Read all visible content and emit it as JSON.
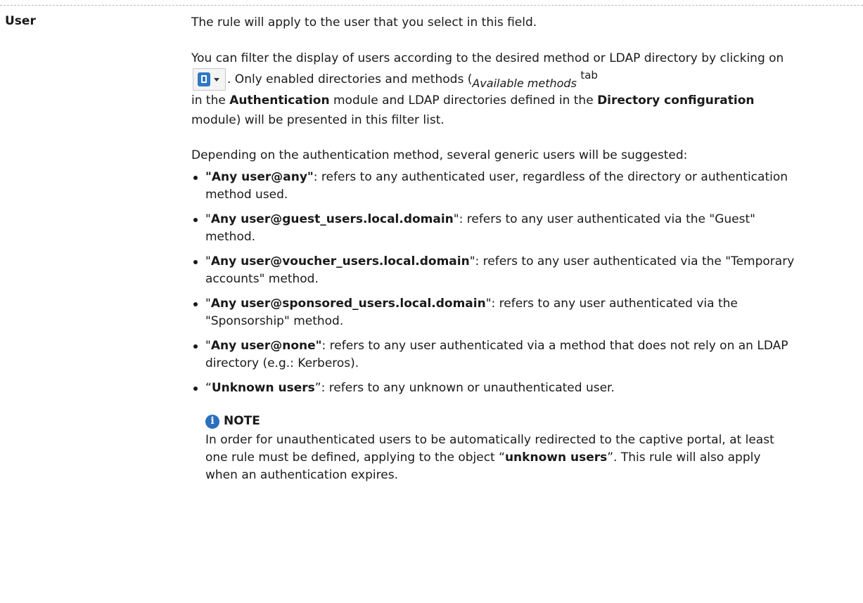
{
  "term": "User",
  "intro": "The rule will apply to the user that you select in this field.",
  "filter": {
    "t1": "You can filter the display of users according to the desired method or LDAP directory by clicking on",
    "t2": ". Only enabled directories and methods (",
    "t3": "Available methods",
    "t4": "tab",
    "t5": "in the",
    "t6": "Authentication",
    "t7": "module and LDAP directories defined in the",
    "t8": "Directory configuration",
    "t9": "module) will be presented in this filter list."
  },
  "depending": "Depending on the authentication method, several generic users will be suggested:",
  "bullets": [
    {
      "pre": "",
      "bold": "\"Any user@any\"",
      "post": ": refers to any authenticated user, regardless of the directory or authentication method used."
    },
    {
      "pre": "\"",
      "bold": "Any user@guest_users.local.domain",
      "post": "\": refers to any user authenticated via the \"Guest\" method."
    },
    {
      "pre": "\"",
      "bold": "Any user@voucher_users.local.domain",
      "post": "\": refers to any user authenticated via the \"Temporary accounts\" method."
    },
    {
      "pre": "\"",
      "bold": "Any user@sponsored_users.local.domain",
      "post": "\": refers to any user authenticated via the \"Sponsorship\" method."
    },
    {
      "pre": "\"",
      "bold": "Any user@none\"",
      "post": ": refers to any user authenticated via a method that does not rely on an LDAP directory (e.g.: Kerberos)."
    },
    {
      "pre": "“",
      "bold": "Unknown users",
      "post": "”: refers to any unknown or unauthenticated user."
    }
  ],
  "note": {
    "title": "NOTE",
    "b1": "In order for unauthenticated users to be automatically redirected to the captive portal, at least one rule must be defined, applying to the object “",
    "b2": "unknown users",
    "b3": "”. This rule will also apply when an authentication expires."
  }
}
